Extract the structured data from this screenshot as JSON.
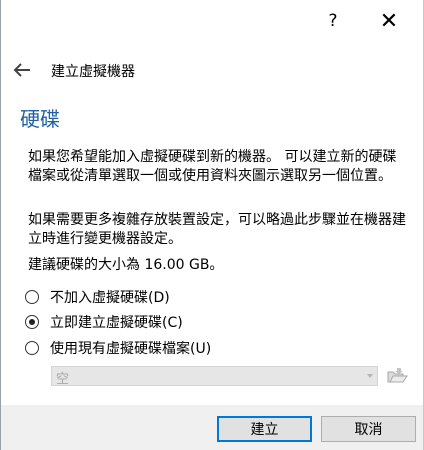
{
  "titlebar": {
    "help_label": "?",
    "close_label": "✕"
  },
  "header": {
    "back_icon": "back-arrow-icon",
    "title": "建立虛擬機器"
  },
  "section": {
    "title": "硬碟"
  },
  "body": {
    "paragraph1": "如果您希望能加入虛擬硬碟到新的機器。 可以建立新的硬碟檔案或從清單選取一個或使用資料夾圖示選取另一個位置。",
    "paragraph2": "如果需要更多複雜存放裝置設定，可以略過此步驟並在機器建立時進行變更機器設定。",
    "recommended_size": "建議硬碟的大小為 16.00 GB。"
  },
  "options": [
    {
      "label": "不加入虛擬硬碟(D)",
      "checked": false
    },
    {
      "label": "立即建立虛擬硬碟(C)",
      "checked": true
    },
    {
      "label": "使用現有虛擬硬碟檔案(U)",
      "checked": false
    }
  ],
  "file_selector": {
    "value": "空",
    "enabled": false,
    "folder_icon": "folder-open-icon"
  },
  "buttons": {
    "create": "建立",
    "cancel": "取消"
  },
  "colors": {
    "section_title": "#1f5fa8",
    "default_button_border": "#0078d7",
    "footer_bg": "#f0f0f0"
  }
}
